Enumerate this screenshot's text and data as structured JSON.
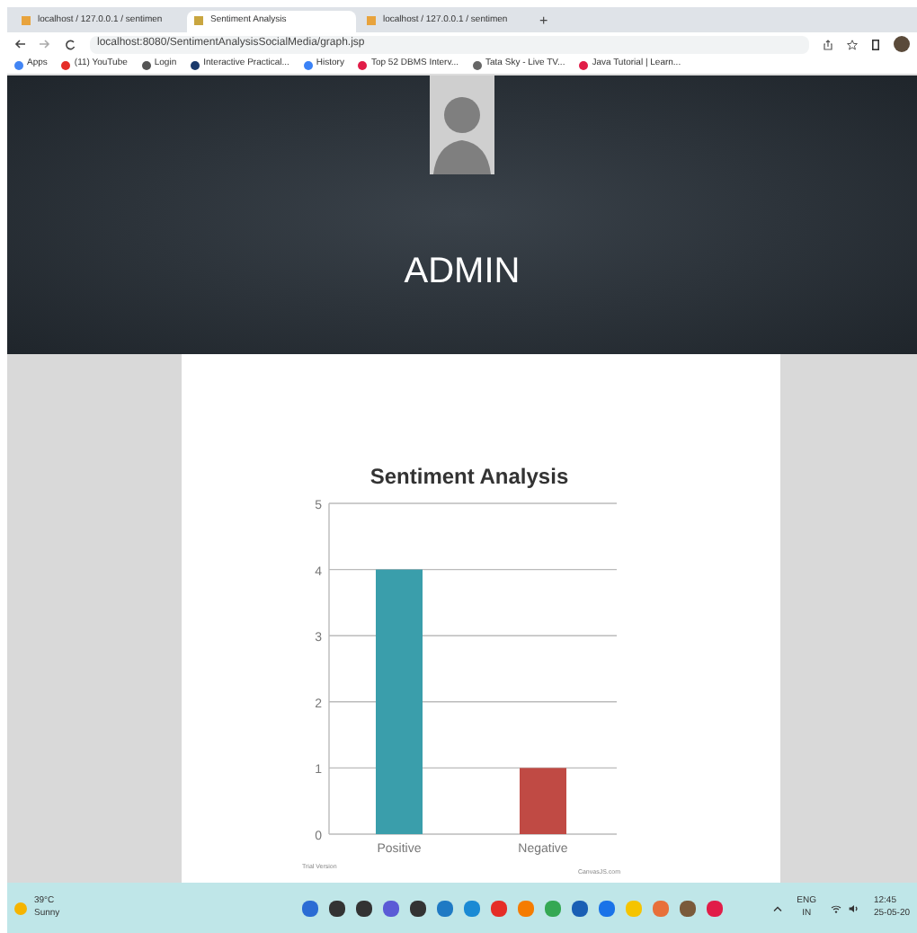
{
  "browser": {
    "tabs": [
      {
        "title": "localhost / 127.0.0.1 / sentimen",
        "selected": false
      },
      {
        "title": "Sentiment Analysis",
        "selected": true
      },
      {
        "title": "localhost / 127.0.0.1 / sentimen",
        "selected": false
      }
    ],
    "new_tab": "+",
    "address": "localhost:8080/SentimentAnalysisSocialMedia/graph.jsp",
    "bookmarks": [
      {
        "label": "Apps",
        "color": "#4285f4"
      },
      {
        "label": "(11) YouTube",
        "color": "#e52d27"
      },
      {
        "label": "Login",
        "color": "#555555"
      },
      {
        "label": "Interactive Practical...",
        "color": "#1a3a6b"
      },
      {
        "label": "History",
        "color": "#3b82f6"
      },
      {
        "label": "Top 52 DBMS Interv...",
        "color": "#e11d48"
      },
      {
        "label": "Tata Sky - Live TV...",
        "color": "#666666"
      },
      {
        "label": "Java Tutorial | Learn...",
        "color": "#e11d48"
      }
    ]
  },
  "header": {
    "name": "ADMIN"
  },
  "chart": {
    "chart_data": {
      "type": "bar",
      "title": "Sentiment Analysis",
      "categories": [
        "Positive",
        "Negative"
      ],
      "series": [
        {
          "values": [
            4,
            1
          ],
          "colors": [
            "#3a9eab",
            "#c04a44"
          ]
        }
      ],
      "ylim": [
        0,
        5
      ],
      "yticks": [
        0,
        1,
        2,
        3,
        4,
        5
      ],
      "grid": true
    },
    "footer_left": "Trial Version",
    "footer_right": "CanvasJS.com"
  },
  "taskbar": {
    "temperature": "39°C",
    "weather": "Sunny",
    "language": "ENG",
    "region": "IN",
    "time": "12:45",
    "date": "25-05-20"
  }
}
